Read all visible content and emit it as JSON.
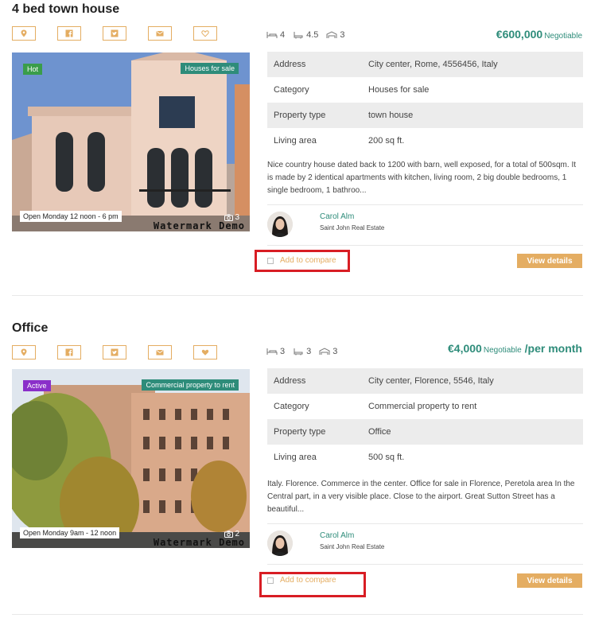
{
  "listings": [
    {
      "title": "4 bed town house",
      "badge_left": "Hot",
      "badge_left_color": "#3a9d4a",
      "badge_right": "Houses for sale",
      "badge_right_color": "#2e8c7a",
      "open_label": "Open Monday 12 noon - 6 pm",
      "photo_count": "3",
      "watermark": "Watermark Demo",
      "features": {
        "beds": "4",
        "baths": "4.5",
        "garages": "3"
      },
      "price": "€600,000",
      "price_suffix": "Negotiable",
      "price_period": "",
      "details": [
        {
          "key": "Address",
          "value": "City center, Rome, 4556456, Italy"
        },
        {
          "key": "Category",
          "value": "Houses for sale"
        },
        {
          "key": "Property type",
          "value": "town house"
        },
        {
          "key": "Living area",
          "value": "200 sq ft."
        }
      ],
      "description": "Nice country house dated back to 1200 with barn, well exposed, for a total of 500sqm. It is made by 2 identical apartments with kitchen, living room, 2 big double bedrooms, 1 single bedroom, 1 bathroo...",
      "agent": {
        "name": "Carol Alm",
        "company": "Saint John Real Estate"
      },
      "compare_label": "Add to compare",
      "view_label": "View details"
    },
    {
      "title": "Office",
      "badge_left": "Active",
      "badge_left_color": "#8a2fc9",
      "badge_right": "Commercial property to rent",
      "badge_right_color": "#2e8c7a",
      "open_label": "Open Monday 9am - 12 noon",
      "photo_count": "2",
      "watermark": "Watermark Demo",
      "features": {
        "beds": "3",
        "baths": "3",
        "garages": "3"
      },
      "price": "€4,000",
      "price_suffix": "Negotiable",
      "price_period": "/per month",
      "details": [
        {
          "key": "Address",
          "value": "City center, Florence, 5546, Italy"
        },
        {
          "key": "Category",
          "value": "Commercial property to rent"
        },
        {
          "key": "Property type",
          "value": "Office"
        },
        {
          "key": "Living area",
          "value": "500 sq ft."
        }
      ],
      "description": "Italy. Florence. Commerce in the center.  Office for sale in Florence, Peretola area In the Central part, in a very visible place. Close to the airport. Great Sutton Street has a beautiful...",
      "agent": {
        "name": "Carol Alm",
        "company": "Saint John Real Estate"
      },
      "compare_label": "Add to compare",
      "view_label": "View details"
    }
  ],
  "share_icons": [
    "map-marker-icon",
    "facebook-icon",
    "twitter-icon",
    "email-icon",
    "heart-icon"
  ],
  "colors": {
    "accent": "#e4ad62",
    "green": "#2e8c7a",
    "highlight": "#d81d24"
  }
}
